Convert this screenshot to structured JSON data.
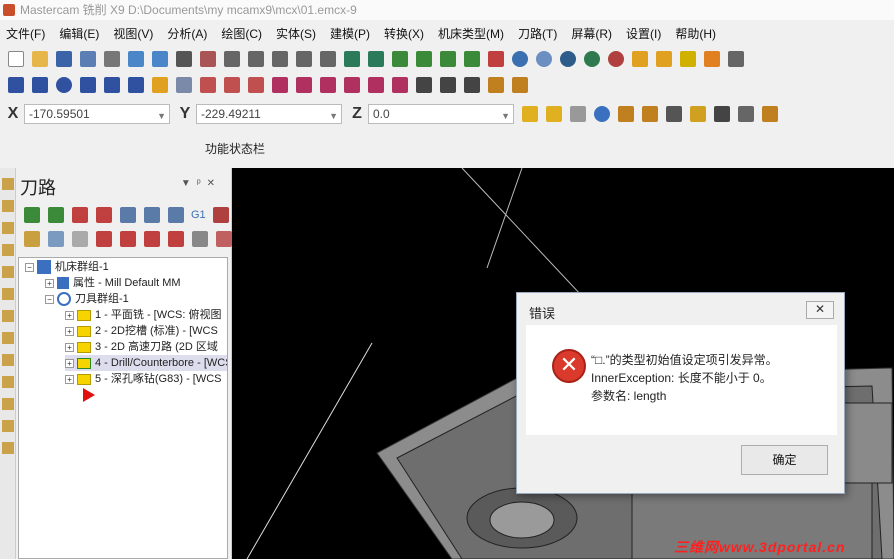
{
  "window": {
    "title": "Mastercam 铣削 X9  D:\\Documents\\my mcamx9\\mcx\\01.emcx-9"
  },
  "menu": [
    "文件(F)",
    "编辑(E)",
    "视图(V)",
    "分析(A)",
    "绘图(C)",
    "实体(S)",
    "建模(P)",
    "转换(X)",
    "机床类型(M)",
    "刀路(T)",
    "屏幕(R)",
    "设置(I)",
    "帮助(H)"
  ],
  "coords": {
    "x_label": "X",
    "x_value": "-170.59501",
    "y_label": "Y",
    "y_value": "-229.49211",
    "z_label": "Z",
    "z_value": "0.0"
  },
  "function_bar": "功能状态栏",
  "panel": {
    "title": "刀路",
    "tree": {
      "machine_group": "机床群组-1",
      "properties": "属性 - Mill Default MM",
      "toolgroup": "刀具群组-1",
      "operations": [
        "1 - 平面铣 - [WCS: 俯视图",
        "2 - 2D挖槽 (标准) - [WCS",
        "3 - 2D 高速刀路 (2D 区域",
        "4 - Drill/Counterbore - [WCS",
        "5 - 深孔啄钻(G83) - [WCS"
      ]
    }
  },
  "toolbar_toggle": "G1",
  "dialog": {
    "title": "错误",
    "close": "✕",
    "line1": "“□.”的类型初始值设定项引发异常。",
    "line2": "InnerException: 长度不能小于 0。",
    "line3": "参数名: length",
    "ok": "确定"
  },
  "watermark": "三维网www.3dportal.cn",
  "colors": {
    "viewport_bg": "#000000",
    "error_red": "#d93a2b",
    "folder_yellow": "#f5d400"
  }
}
